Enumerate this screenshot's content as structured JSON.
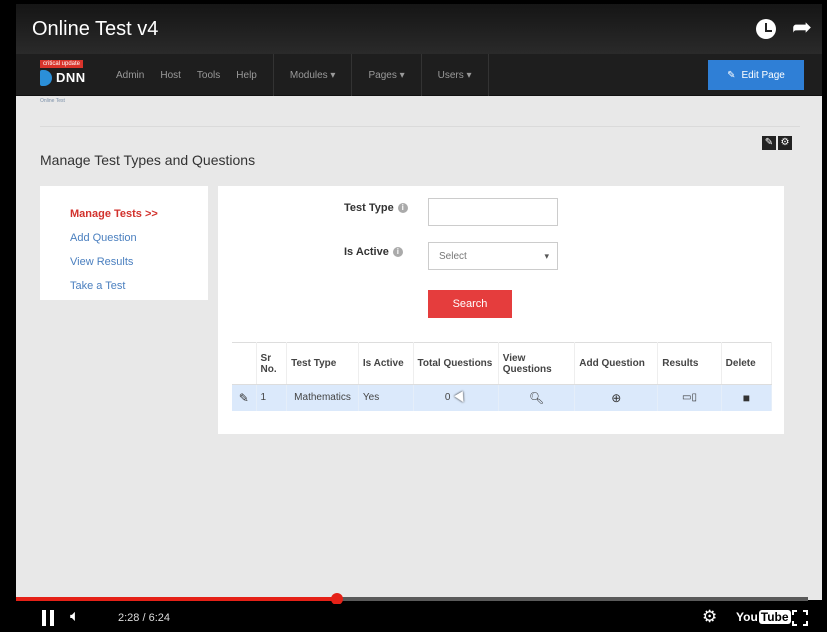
{
  "video": {
    "title": "Online Test v4",
    "time_display": "2:28 / 6:24",
    "progress": 0.405
  },
  "dnn_bar": {
    "critical_label": "critical update",
    "logo_text": "DNN",
    "sub_label": "Online Test",
    "menu": [
      "Admin",
      "Host",
      "Tools",
      "Help"
    ],
    "dropdown_menu": [
      "Modules ▾",
      "Pages ▾",
      "Users ▾"
    ],
    "edit_page_label": "Edit Page"
  },
  "module": {
    "title": "Manage Test Types and Questions"
  },
  "sidebar": {
    "items": [
      {
        "label": "Manage Tests >>"
      },
      {
        "label": "Add Question"
      },
      {
        "label": "View Results"
      },
      {
        "label": "Take a Test"
      }
    ]
  },
  "form": {
    "test_type_label": "Test Type",
    "is_active_label": "Is Active",
    "select_value": "Select",
    "search_label": "Search",
    "info_icon": "ⓘ"
  },
  "grid": {
    "headers": [
      "Sr No.",
      "Test Type",
      "Is Active",
      "Total Questions",
      "View Questions",
      "Add Question",
      "Results",
      "Delete"
    ],
    "rows": [
      {
        "sr": "1",
        "test_type": "Mathematics",
        "is_active": "Yes",
        "total": "0"
      }
    ]
  }
}
